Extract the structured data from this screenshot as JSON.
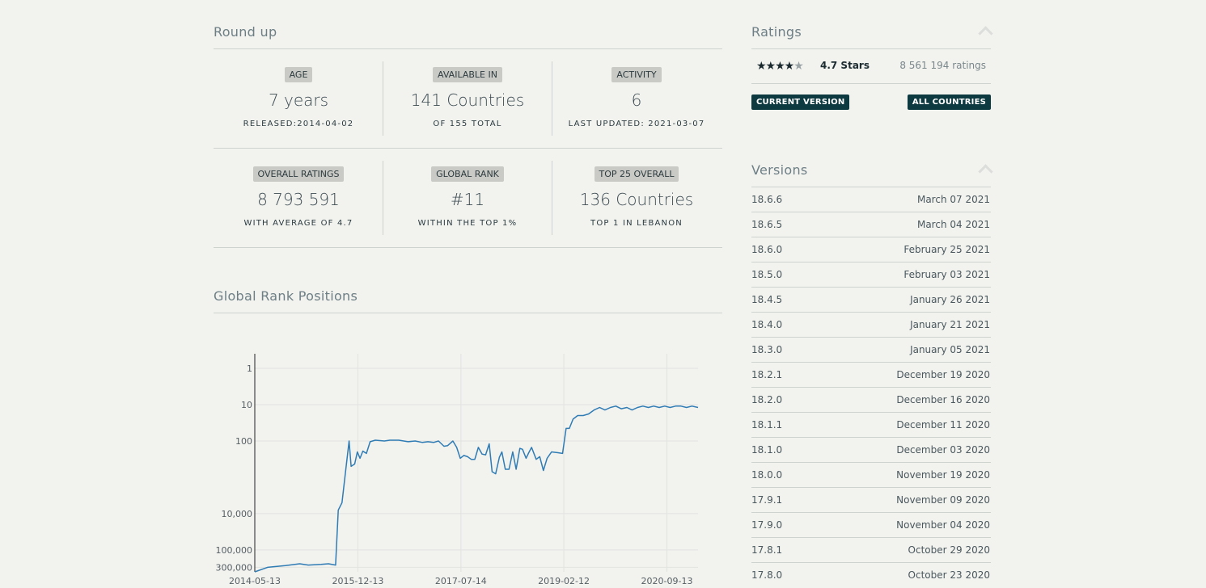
{
  "roundup": {
    "title": "Round up",
    "cells": [
      {
        "badge": "AGE",
        "value": "7 years",
        "sub": "RELEASED:2014-04-02"
      },
      {
        "badge": "AVAILABLE IN",
        "value": "141 Countries",
        "sub": "OF 155 TOTAL"
      },
      {
        "badge": "ACTIVITY",
        "value": "6",
        "sub": "LAST UPDATED: 2021-03-07"
      },
      {
        "badge": "OVERALL RATINGS",
        "value": "8 793 591",
        "sub": "WITH AVERAGE OF 4.7"
      },
      {
        "badge": "GLOBAL RANK",
        "value": "#11",
        "sub": "WITHIN THE TOP 1%"
      },
      {
        "badge": "TOP 25 OVERALL",
        "value": "136 Countries",
        "sub": "TOP 1 IN LEBANON"
      }
    ]
  },
  "ratings": {
    "title": "Ratings",
    "stars_label": "4.7 Stars",
    "count_label": "8 561 194 ratings",
    "btn_current": "CURRENT VERSION",
    "btn_all": "ALL COUNTRIES"
  },
  "versions": {
    "title": "Versions",
    "items": [
      {
        "name": "18.6.6",
        "date": "March 07 2021"
      },
      {
        "name": "18.6.5",
        "date": "March 04 2021"
      },
      {
        "name": "18.6.0",
        "date": "February 25 2021"
      },
      {
        "name": "18.5.0",
        "date": "February 03 2021"
      },
      {
        "name": "18.4.5",
        "date": "January 26 2021"
      },
      {
        "name": "18.4.0",
        "date": "January 21 2021"
      },
      {
        "name": "18.3.0",
        "date": "January 05 2021"
      },
      {
        "name": "18.2.1",
        "date": "December 19 2020"
      },
      {
        "name": "18.2.0",
        "date": "December 16 2020"
      },
      {
        "name": "18.1.1",
        "date": "December 11 2020"
      },
      {
        "name": "18.1.0",
        "date": "December 03 2020"
      },
      {
        "name": "18.0.0",
        "date": "November 19 2020"
      },
      {
        "name": "17.9.1",
        "date": "November 09 2020"
      },
      {
        "name": "17.9.0",
        "date": "November 04 2020"
      },
      {
        "name": "17.8.1",
        "date": "October 29 2020"
      },
      {
        "name": "17.8.0",
        "date": "October 23 2020"
      }
    ]
  },
  "chart_title": "Global Rank Positions",
  "colors": {
    "line": "#2f7cb4",
    "badge_bg": "#c9cac5",
    "tag_bg": "#0d3a40"
  },
  "chart_data": {
    "type": "line",
    "title": "Global Rank Positions",
    "y_scale": "log",
    "y_reversed": true,
    "ylim": [
      1,
      400000
    ],
    "y_ticks": [
      1,
      10,
      100,
      10000,
      100000,
      300000
    ],
    "y_tick_labels": [
      "1",
      "10",
      "100",
      "10,000",
      "100,000",
      "300,000"
    ],
    "x_ticks": [
      "2014-05-13",
      "2015-12-13",
      "2017-07-14",
      "2019-02-12",
      "2020-09-13"
    ],
    "xlim": [
      "2014-05-13",
      "2021-03-07"
    ],
    "grid": true,
    "series": [
      {
        "values": [
          [
            "2014-05-13",
            400000
          ],
          [
            "2014-07-24",
            300000
          ],
          [
            "2014-11-01",
            270000
          ],
          [
            "2015-01-20",
            240000
          ],
          [
            "2015-03-10",
            260000
          ],
          [
            "2015-05-20",
            250000
          ],
          [
            "2015-07-01",
            240000
          ],
          [
            "2015-08-10",
            260000
          ],
          [
            "2015-08-25",
            8000
          ],
          [
            "2015-09-15",
            5000
          ],
          [
            "2015-10-05",
            700
          ],
          [
            "2015-10-25",
            100
          ],
          [
            "2015-11-05",
            500
          ],
          [
            "2015-11-25",
            430
          ],
          [
            "2015-12-10",
            200
          ],
          [
            "2015-12-25",
            300
          ],
          [
            "2016-01-10",
            190
          ],
          [
            "2016-01-30",
            220
          ],
          [
            "2016-02-20",
            105
          ],
          [
            "2016-03-20",
            95
          ],
          [
            "2016-05-10",
            100
          ],
          [
            "2016-06-10",
            95
          ],
          [
            "2016-07-30",
            95
          ],
          [
            "2016-09-20",
            105
          ],
          [
            "2016-10-30",
            100
          ],
          [
            "2016-12-10",
            110
          ],
          [
            "2017-01-10",
            105
          ],
          [
            "2017-02-10",
            110
          ],
          [
            "2017-03-10",
            100
          ],
          [
            "2017-04-10",
            140
          ],
          [
            "2017-04-30",
            135
          ],
          [
            "2017-05-30",
            100
          ],
          [
            "2017-06-20",
            150
          ],
          [
            "2017-07-10",
            300
          ],
          [
            "2017-07-30",
            250
          ],
          [
            "2017-08-20",
            270
          ],
          [
            "2017-09-10",
            320
          ],
          [
            "2017-09-30",
            320
          ],
          [
            "2017-10-20",
            150
          ],
          [
            "2017-11-10",
            230
          ],
          [
            "2017-11-30",
            240
          ],
          [
            "2017-12-20",
            120
          ],
          [
            "2018-01-05",
            700
          ],
          [
            "2018-01-25",
            800
          ],
          [
            "2018-02-15",
            280
          ],
          [
            "2018-03-01",
            200
          ],
          [
            "2018-03-20",
            600
          ],
          [
            "2018-04-10",
            600
          ],
          [
            "2018-05-01",
            200
          ],
          [
            "2018-05-20",
            600
          ],
          [
            "2018-06-10",
            160
          ],
          [
            "2018-06-25",
            170
          ],
          [
            "2018-07-15",
            300
          ],
          [
            "2018-07-30",
            210
          ],
          [
            "2018-08-15",
            150
          ],
          [
            "2018-09-10",
            320
          ],
          [
            "2018-09-30",
            270
          ],
          [
            "2018-10-20",
            650
          ],
          [
            "2018-11-10",
            300
          ],
          [
            "2018-12-05",
            200
          ],
          [
            "2019-01-10",
            210
          ],
          [
            "2019-02-05",
            220
          ],
          [
            "2019-02-25",
            45
          ],
          [
            "2019-03-15",
            45
          ],
          [
            "2019-04-05",
            25
          ],
          [
            "2019-05-01",
            20
          ],
          [
            "2019-06-01",
            20
          ],
          [
            "2019-07-01",
            18
          ],
          [
            "2019-08-01",
            14
          ],
          [
            "2019-09-01",
            12
          ],
          [
            "2019-10-01",
            14
          ],
          [
            "2019-11-01",
            12
          ],
          [
            "2019-12-01",
            11
          ],
          [
            "2020-01-01",
            13
          ],
          [
            "2020-02-01",
            12
          ],
          [
            "2020-03-01",
            14
          ],
          [
            "2020-04-01",
            12
          ],
          [
            "2020-05-01",
            11
          ],
          [
            "2020-06-01",
            12
          ],
          [
            "2020-07-01",
            11
          ],
          [
            "2020-08-01",
            12
          ],
          [
            "2020-09-01",
            11
          ],
          [
            "2020-10-01",
            12
          ],
          [
            "2020-11-01",
            11
          ],
          [
            "2020-12-01",
            11
          ],
          [
            "2021-01-01",
            12
          ],
          [
            "2021-02-01",
            11
          ],
          [
            "2021-03-07",
            12
          ]
        ]
      }
    ]
  }
}
